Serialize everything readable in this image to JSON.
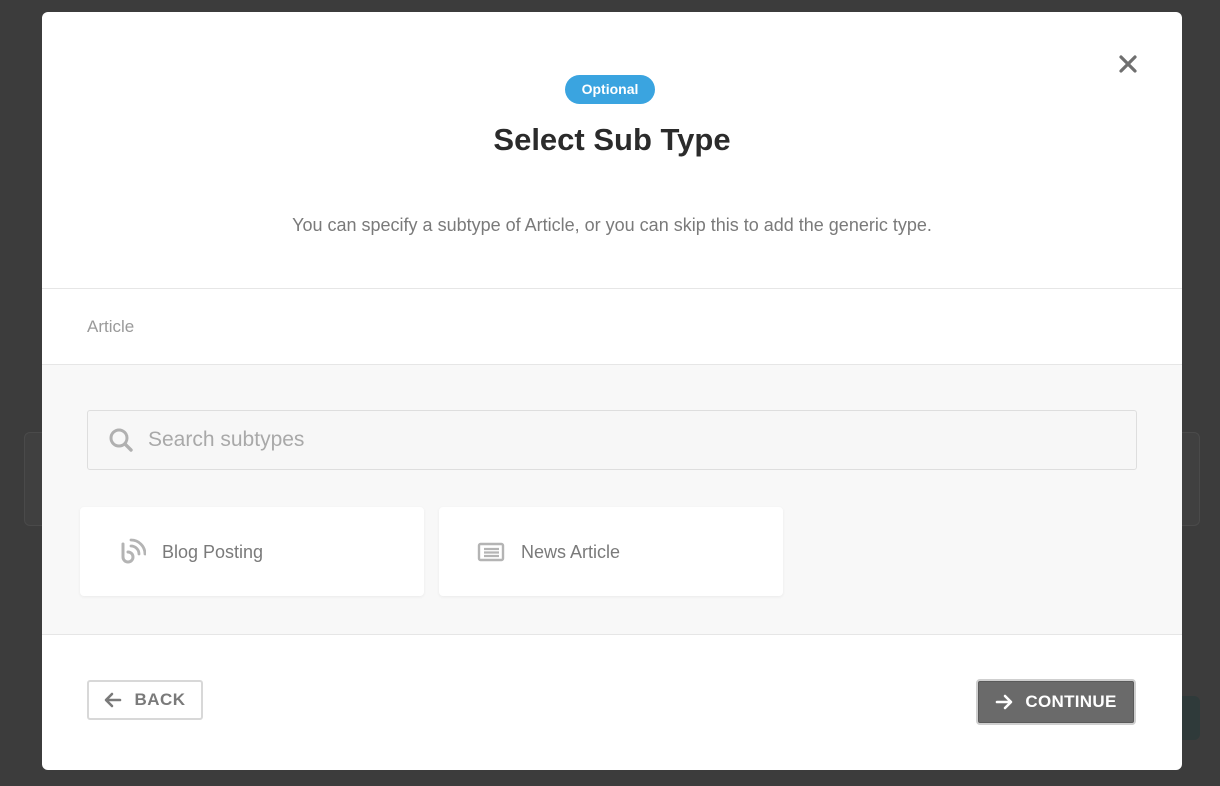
{
  "modal": {
    "badge": "Optional",
    "title": "Select Sub Type",
    "subtitle": "You can specify a subtype of Article, or you can skip this to add the generic type.",
    "breadcrumb": "Article"
  },
  "search": {
    "placeholder": "Search subtypes",
    "value": ""
  },
  "subtypes": [
    {
      "label": "Blog Posting",
      "icon": "blog-rss-icon"
    },
    {
      "label": "News Article",
      "icon": "newspaper-icon"
    }
  ],
  "footer": {
    "back_label": "BACK",
    "continue_label": "CONTINUE"
  },
  "colors": {
    "badge": "#3aa4e0",
    "continue_bg": "#6a6a6a",
    "overlay": "#3c3c3c"
  }
}
